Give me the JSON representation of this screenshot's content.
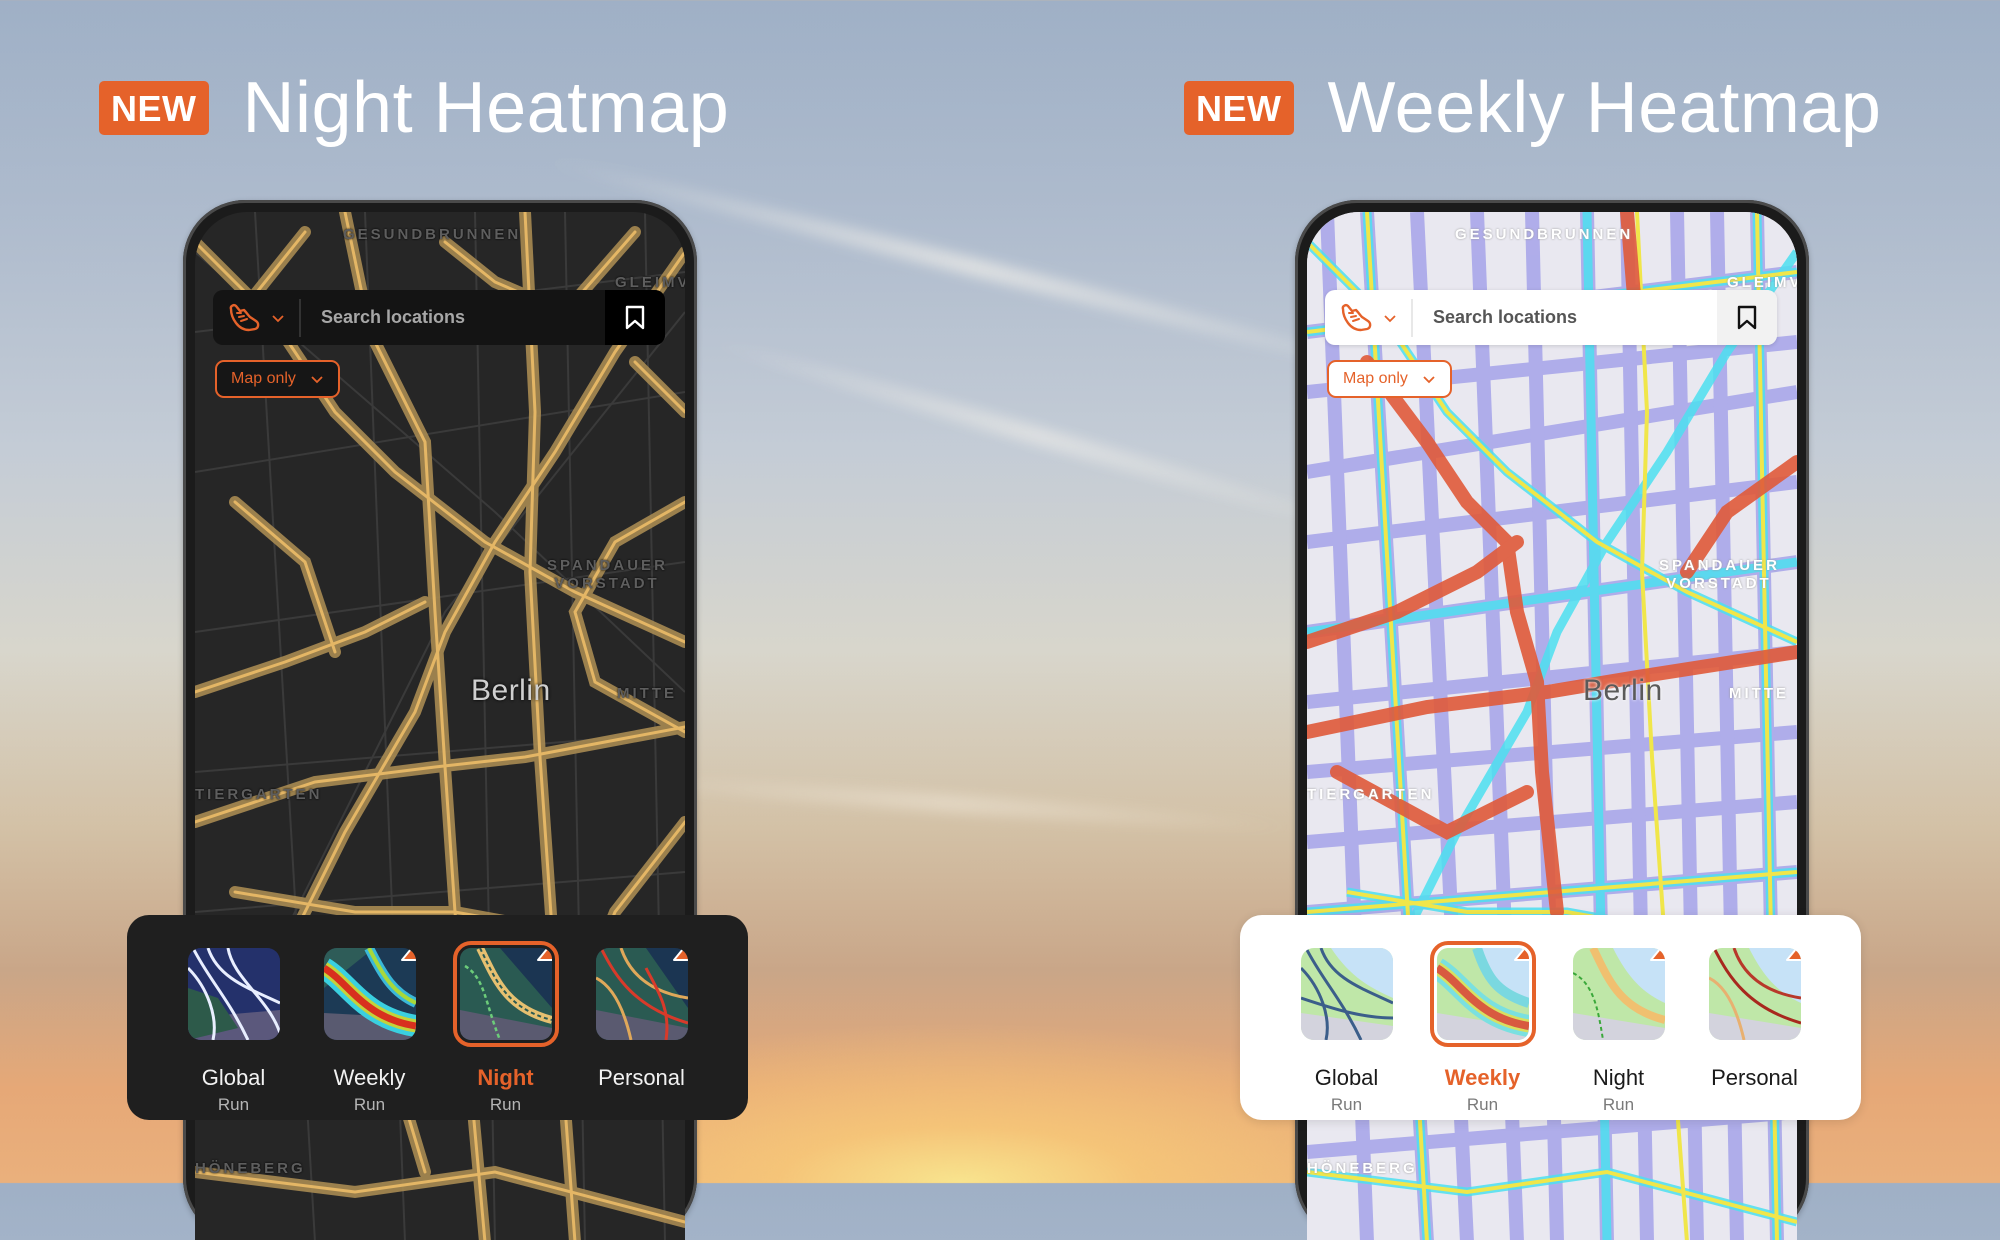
{
  "background": {
    "description": "sunset sky"
  },
  "colors": {
    "accent": "#e5622a",
    "night_route": "#d9aa5a",
    "dark_map": "#262626",
    "light_map": "#ececf2"
  },
  "panels": [
    {
      "badge": "NEW",
      "title": "Night Heatmap",
      "theme": "dark",
      "search": {
        "sport_icon": "shoe-icon",
        "placeholder": "Search locations",
        "bookmark_icon": "bookmark-icon"
      },
      "map_filter": {
        "label": "Map only"
      },
      "map_labels": {
        "north": "GESUNDBRUNNEN",
        "northeast": "GLEIMVIE",
        "district": "SPANDAUER VORSTADT",
        "city": "Berlin",
        "east": "MITTE",
        "west": "TIERGARTEN",
        "south": "HÖNEBERG"
      },
      "tiles": [
        {
          "label": "Global",
          "sub": "Run",
          "premium": false,
          "selected": false
        },
        {
          "label": "Weekly",
          "sub": "Run",
          "premium": true,
          "selected": false
        },
        {
          "label": "Night",
          "sub": "Run",
          "premium": true,
          "selected": true
        },
        {
          "label": "Personal",
          "sub": "",
          "premium": true,
          "selected": false
        }
      ]
    },
    {
      "badge": "NEW",
      "title": "Weekly Heatmap",
      "theme": "light",
      "search": {
        "sport_icon": "shoe-icon",
        "placeholder": "Search locations",
        "bookmark_icon": "bookmark-icon"
      },
      "map_filter": {
        "label": "Map only"
      },
      "map_labels": {
        "north": "GESUNDBRUNNEN",
        "northeast": "GLEIMVIE",
        "district": "SPANDAUER VORSTADT",
        "city": "Berlin",
        "east": "MITTE",
        "west": "TIERGARTEN",
        "south": "HÖNEBERG"
      },
      "tiles": [
        {
          "label": "Global",
          "sub": "Run",
          "premium": false,
          "selected": false
        },
        {
          "label": "Weekly",
          "sub": "Run",
          "premium": true,
          "selected": true
        },
        {
          "label": "Night",
          "sub": "Run",
          "premium": true,
          "selected": false
        },
        {
          "label": "Personal",
          "sub": "",
          "premium": true,
          "selected": false
        }
      ]
    }
  ]
}
